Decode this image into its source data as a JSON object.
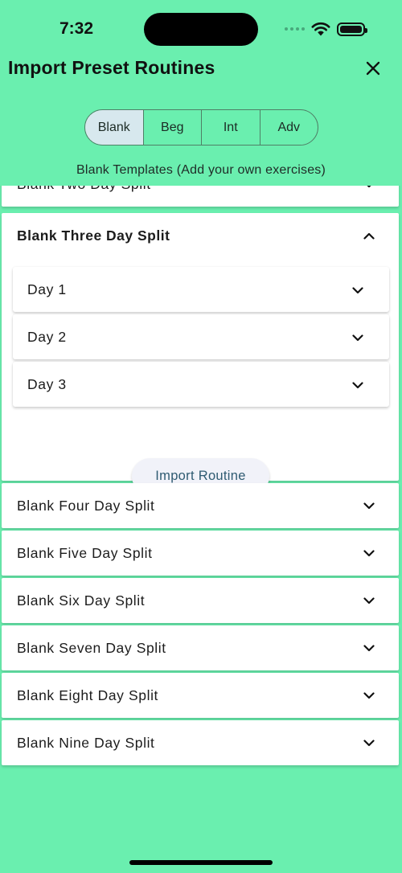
{
  "status_bar": {
    "time": "7:32"
  },
  "header": {
    "title": "Import Preset Routines"
  },
  "segments": [
    {
      "label": "Blank",
      "active": true
    },
    {
      "label": "Beg",
      "active": false
    },
    {
      "label": "Int",
      "active": false
    },
    {
      "label": "Adv",
      "active": false
    }
  ],
  "subtitle": "Blank Templates (Add your own exercises)",
  "routines": {
    "two_day": "Blank Two Day Split",
    "three_day": {
      "title": "Blank Three Day Split",
      "days": [
        "Day 1",
        "Day 2",
        "Day 3"
      ],
      "import_label": "Import Routine"
    },
    "four_day": "Blank Four Day Split",
    "five_day": "Blank Five Day Split",
    "six_day": "Blank Six Day Split",
    "seven_day": "Blank Seven Day Split",
    "eight_day": "Blank Eight Day Split",
    "nine_day": "Blank Nine Day Split"
  },
  "colors": {
    "background": "#6aefaf",
    "active_segment": "#d7e8ee",
    "import_button_text": "#2f5b72"
  }
}
